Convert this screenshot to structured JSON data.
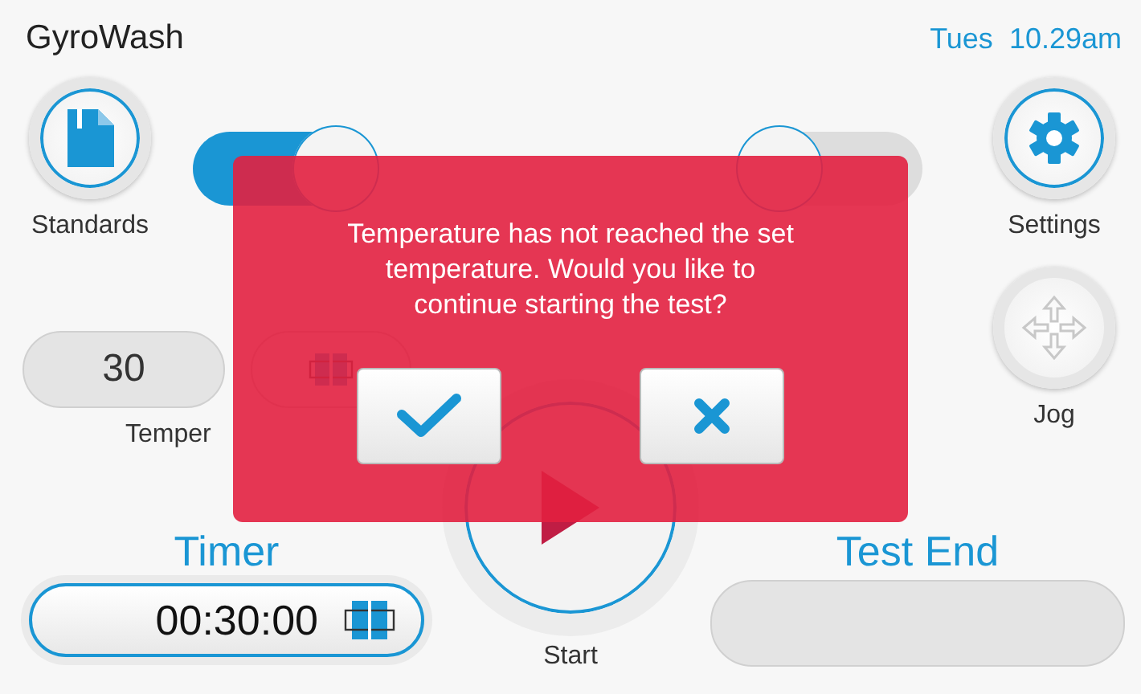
{
  "header": {
    "title": "GyroWash",
    "day": "Tues",
    "time": "10.29am"
  },
  "nav": [
    {
      "kind": "standards",
      "label": "Standards"
    },
    {
      "kind": "settings",
      "label": "Settings"
    },
    {
      "kind": "jog",
      "label": "Jog",
      "disabled": true
    }
  ],
  "toggles": [
    {
      "on": true
    },
    {
      "on": false
    }
  ],
  "temperature": {
    "current": "30",
    "label": "Temper"
  },
  "start": {
    "label": "Start"
  },
  "timer": {
    "label": "Timer",
    "value": "00:30:00"
  },
  "test_end": {
    "label": "Test End"
  },
  "dialog": {
    "message": "Temperature has not reached the set temperature. Would you like to continue starting the test?",
    "buttons": [
      {
        "kind": "confirm"
      },
      {
        "kind": "cancel"
      }
    ]
  }
}
